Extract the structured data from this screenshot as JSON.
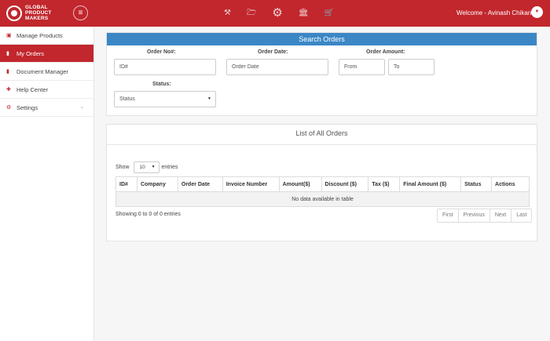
{
  "header": {
    "logo_text": [
      "GLOBAL",
      "PRODUCT",
      "MAKERS"
    ],
    "welcome_text": "Welcome - Avinash Chikane",
    "icons": [
      "hammer-icon",
      "folder-icon",
      "gears-icon",
      "bank-icon",
      "cart-icon"
    ],
    "brand_color": "#c1272d"
  },
  "sidebar": {
    "items": [
      {
        "label": "Manage Products",
        "icon": "box-icon",
        "active": false
      },
      {
        "label": "My Orders",
        "icon": "document-icon",
        "active": true
      },
      {
        "label": "Document Manager",
        "icon": "file-icon",
        "active": false
      },
      {
        "label": "Help Center",
        "icon": "lifebuoy-icon",
        "active": false
      },
      {
        "label": "Settings",
        "icon": "gear-icon",
        "active": false,
        "has_submenu": true
      }
    ]
  },
  "search": {
    "title": "Search Orders",
    "title_color": "#3b87c6",
    "order_no_label": "Order No#:",
    "order_no_placeholder": "ID#",
    "order_date_label": "Order Date:",
    "order_date_placeholder": "Order Date",
    "order_amount_label": "Order Amount:",
    "amount_from_placeholder": "From",
    "amount_to_placeholder": "To",
    "status_label": "Status:",
    "status_value": "Status"
  },
  "orders": {
    "title": "List of All Orders",
    "show_label": "Show",
    "page_length": "10",
    "entries_label": "entries",
    "columns": [
      "ID#",
      "Company",
      "Order Date",
      "Invoice Number",
      "Amount($)",
      "Discount ($)",
      "Tax ($)",
      "Final Amount ($)",
      "Status",
      "Actions"
    ],
    "empty_message": "No data available in table",
    "info": "Showing 0 to 0 of 0 entries",
    "pagination": [
      "First",
      "Previous",
      "Next",
      "Last"
    ]
  }
}
